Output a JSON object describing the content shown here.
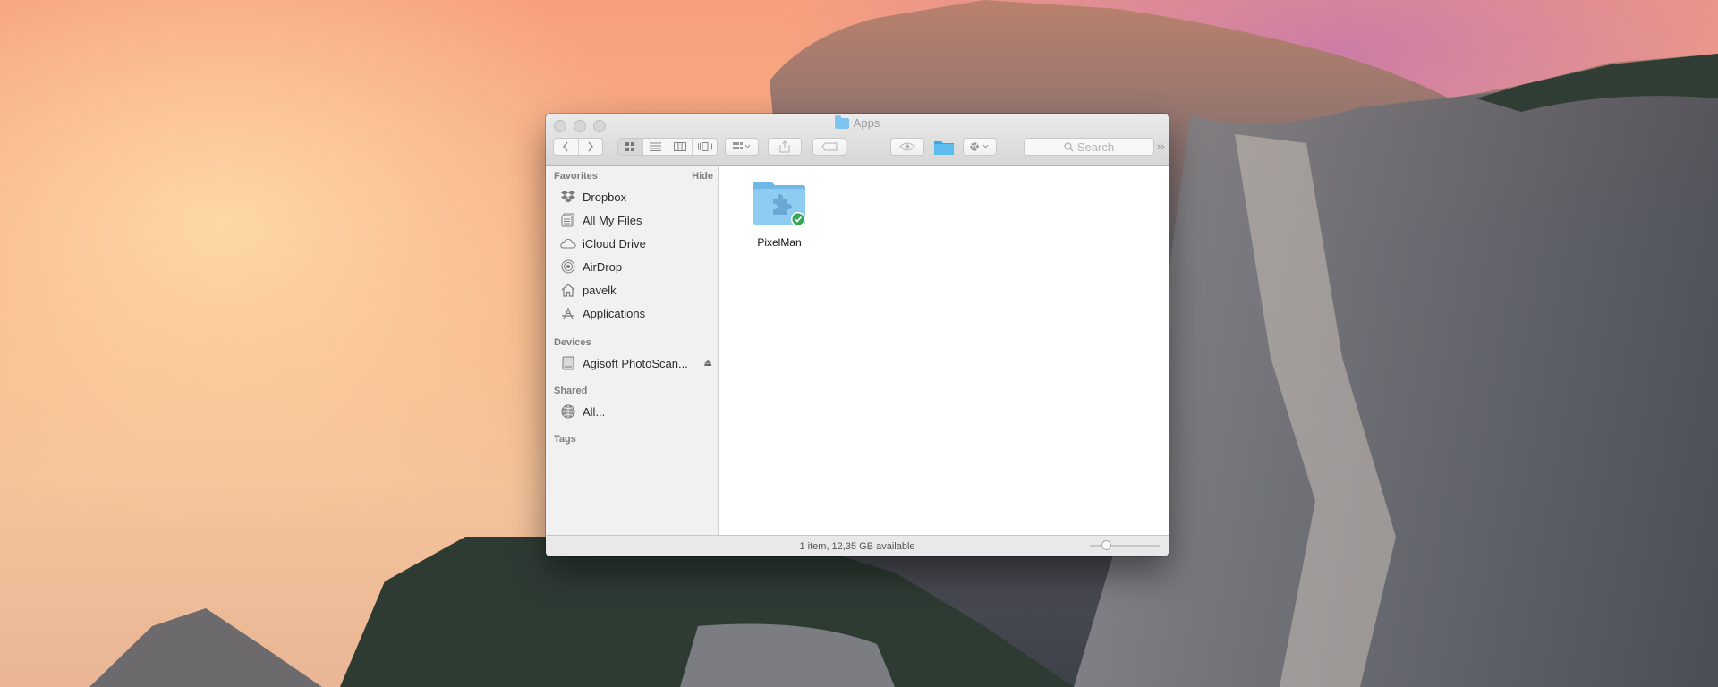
{
  "window": {
    "title": "Apps",
    "search_placeholder": "Search",
    "status_text": "1 item, 12,35 GB available",
    "icon_size_zoom": 0.2
  },
  "sidebar": {
    "favorites_header": "Favorites",
    "hide_label": "Hide",
    "favorites": [
      {
        "label": "Dropbox",
        "icon": "dropbox-icon"
      },
      {
        "label": "All My Files",
        "icon": "all-files-icon"
      },
      {
        "label": "iCloud Drive",
        "icon": "cloud-icon"
      },
      {
        "label": "AirDrop",
        "icon": "airdrop-icon"
      },
      {
        "label": "pavelk",
        "icon": "home-icon"
      },
      {
        "label": "Applications",
        "icon": "applications-icon"
      }
    ],
    "devices_header": "Devices",
    "devices": [
      {
        "label": "Agisoft PhotoScan...",
        "icon": "disk-icon"
      }
    ],
    "shared_header": "Shared",
    "shared": [
      {
        "label": "All...",
        "icon": "network-icon"
      }
    ],
    "tags_header": "Tags"
  },
  "files": [
    {
      "name": "PixelMan",
      "icon": "app-folder-icon",
      "status": "synced"
    }
  ],
  "colors": {
    "folder": "#7ec4ee",
    "sync_badge": "#2fa84f"
  }
}
